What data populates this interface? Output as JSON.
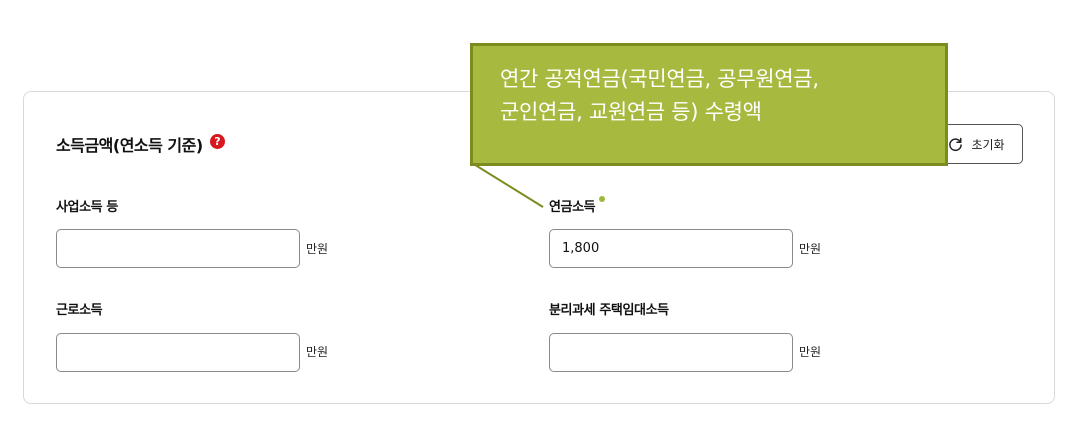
{
  "section": {
    "title": "소득금액(연소득 기준)",
    "help_icon": "question-circle-icon",
    "help_color": "#d7191f"
  },
  "reset_button": {
    "label": "초기화",
    "icon": "refresh-icon"
  },
  "fields": {
    "business_income": {
      "label": "사업소득 등",
      "value": "",
      "unit": "만원"
    },
    "pension_income": {
      "label": "연금소득",
      "value": "1,800",
      "unit": "만원"
    },
    "earned_income": {
      "label": "근로소득",
      "value": "",
      "unit": "만원"
    },
    "rental_income": {
      "label": "분리과세 주택임대소득",
      "value": "",
      "unit": "만원"
    }
  },
  "tooltip": {
    "lines": [
      "연간 공적연금(국민연금, 공무원연금,",
      "군인연금, 교원연금 등) 수령액"
    ],
    "background": "#a8b93f",
    "border": "#7e8c1f"
  },
  "colors": {
    "accent_dot": "#9bba3a"
  }
}
